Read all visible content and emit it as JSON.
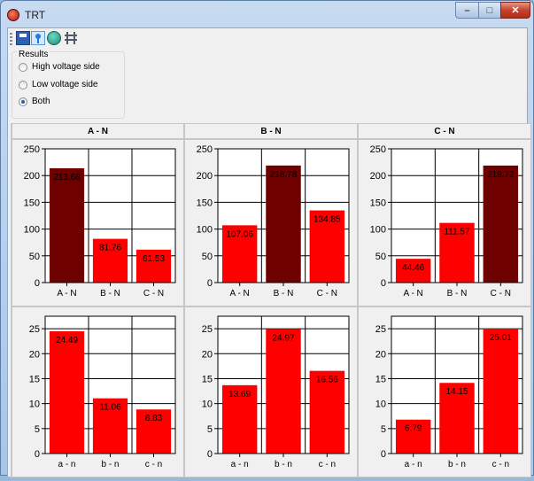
{
  "window": {
    "title": "TRT",
    "buttons": {
      "minimize": "–",
      "maximize": "□",
      "close": "✕"
    }
  },
  "toolbar": {
    "icons": [
      "save-icon",
      "pin-icon",
      "globe-icon",
      "tower-icon"
    ]
  },
  "results": {
    "legend": "Results",
    "options": [
      {
        "label": "High voltage side",
        "selected": false
      },
      {
        "label": "Low voltage side",
        "selected": false
      },
      {
        "label": "Both",
        "selected": true
      }
    ]
  },
  "columns": [
    "A - N",
    "B - N",
    "C - N"
  ],
  "colors": {
    "bar": "#ff0000",
    "highlight": "#6e0000"
  },
  "chart_data": [
    {
      "type": "bar",
      "categories": [
        "A - N",
        "B - N",
        "C - N"
      ],
      "values": [
        213.68,
        81.76,
        61.53
      ],
      "labels": [
        "213.68",
        "81.76",
        "61.53"
      ],
      "highlight": 0,
      "ylim": [
        0,
        250
      ],
      "ticks": [
        0,
        50,
        100,
        150,
        200,
        250
      ]
    },
    {
      "type": "bar",
      "categories": [
        "A - N",
        "B - N",
        "C - N"
      ],
      "values": [
        107.06,
        218.78,
        134.85
      ],
      "labels": [
        "107.06",
        "218.78",
        "134.85"
      ],
      "highlight": 1,
      "ylim": [
        0,
        250
      ],
      "ticks": [
        0,
        50,
        100,
        150,
        200,
        250
      ]
    },
    {
      "type": "bar",
      "categories": [
        "A - N",
        "B - N",
        "C - N"
      ],
      "values": [
        44.46,
        111.57,
        218.72
      ],
      "labels": [
        "44.46",
        "111.57",
        "218.72"
      ],
      "highlight": 2,
      "ylim": [
        0,
        250
      ],
      "ticks": [
        0,
        50,
        100,
        150,
        200,
        250
      ]
    },
    {
      "type": "bar",
      "categories": [
        "a - n",
        "b - n",
        "c - n"
      ],
      "values": [
        24.49,
        11.06,
        8.83
      ],
      "labels": [
        "24.49",
        "11.06",
        "8.83"
      ],
      "highlight": -1,
      "ylim": [
        0,
        27.5
      ],
      "ticks": [
        0,
        5,
        10,
        15,
        20,
        25
      ]
    },
    {
      "type": "bar",
      "categories": [
        "a - n",
        "b - n",
        "c - n"
      ],
      "values": [
        13.69,
        24.97,
        16.56
      ],
      "labels": [
        "13.69",
        "24.97",
        "16.56"
      ],
      "highlight": -1,
      "ylim": [
        0,
        27.5
      ],
      "ticks": [
        0,
        5,
        10,
        15,
        20,
        25
      ]
    },
    {
      "type": "bar",
      "categories": [
        "a - n",
        "b - n",
        "c - n"
      ],
      "values": [
        6.79,
        14.15,
        25.01
      ],
      "labels": [
        "6.79",
        "14.15",
        "25.01"
      ],
      "highlight": -1,
      "ylim": [
        0,
        27.5
      ],
      "ticks": [
        0,
        5,
        10,
        15,
        20,
        25
      ]
    }
  ]
}
